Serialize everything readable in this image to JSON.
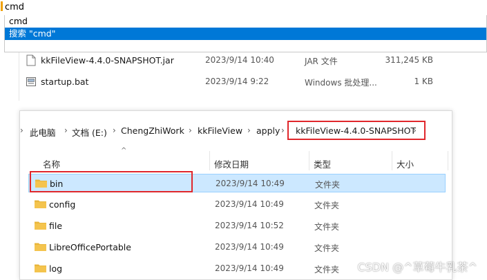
{
  "address_bar": {
    "value": "cmd"
  },
  "autocomplete": {
    "items": [
      "cmd",
      "搜索 \"cmd\""
    ]
  },
  "background_files": [
    {
      "name": "kkFileView-4.4.0-SNAPSHOT.jar",
      "date": "2023/9/14 10:40",
      "type": "JAR 文件",
      "size": "311,245 KB",
      "icon": "jar-file-icon"
    },
    {
      "name": "startup.bat",
      "date": "2023/9/14 9:22",
      "type": "Windows 批处理...",
      "size": "1 KB",
      "icon": "batch-file-icon"
    }
  ],
  "breadcrumb": {
    "items": [
      "此电脑",
      "文档 (E:)",
      "ChengZhiWork",
      "kkFileView",
      "apply",
      "kkFileView-4.4.0-SNAPSHOT"
    ]
  },
  "columns": {
    "name": "名称",
    "date": "修改日期",
    "type": "类型",
    "size": "大小"
  },
  "rows": [
    {
      "name": "bin",
      "date": "2023/9/14 10:49",
      "type": "文件夹",
      "selected": true
    },
    {
      "name": "config",
      "date": "2023/9/14 10:49",
      "type": "文件夹"
    },
    {
      "name": "file",
      "date": "2023/9/14 10:52",
      "type": "文件夹"
    },
    {
      "name": "LibreOfficePortable",
      "date": "2023/9/14 10:49",
      "type": "文件夹"
    },
    {
      "name": "log",
      "date": "2023/9/14 10:49",
      "type": "文件夹"
    }
  ],
  "watermark": "CSDN @^草莓牛乳茶^",
  "colors": {
    "selection": "#0078d7",
    "highlight_box": "#e0262b",
    "row_selected": "#cce8ff",
    "folder": "#f4c44e"
  }
}
